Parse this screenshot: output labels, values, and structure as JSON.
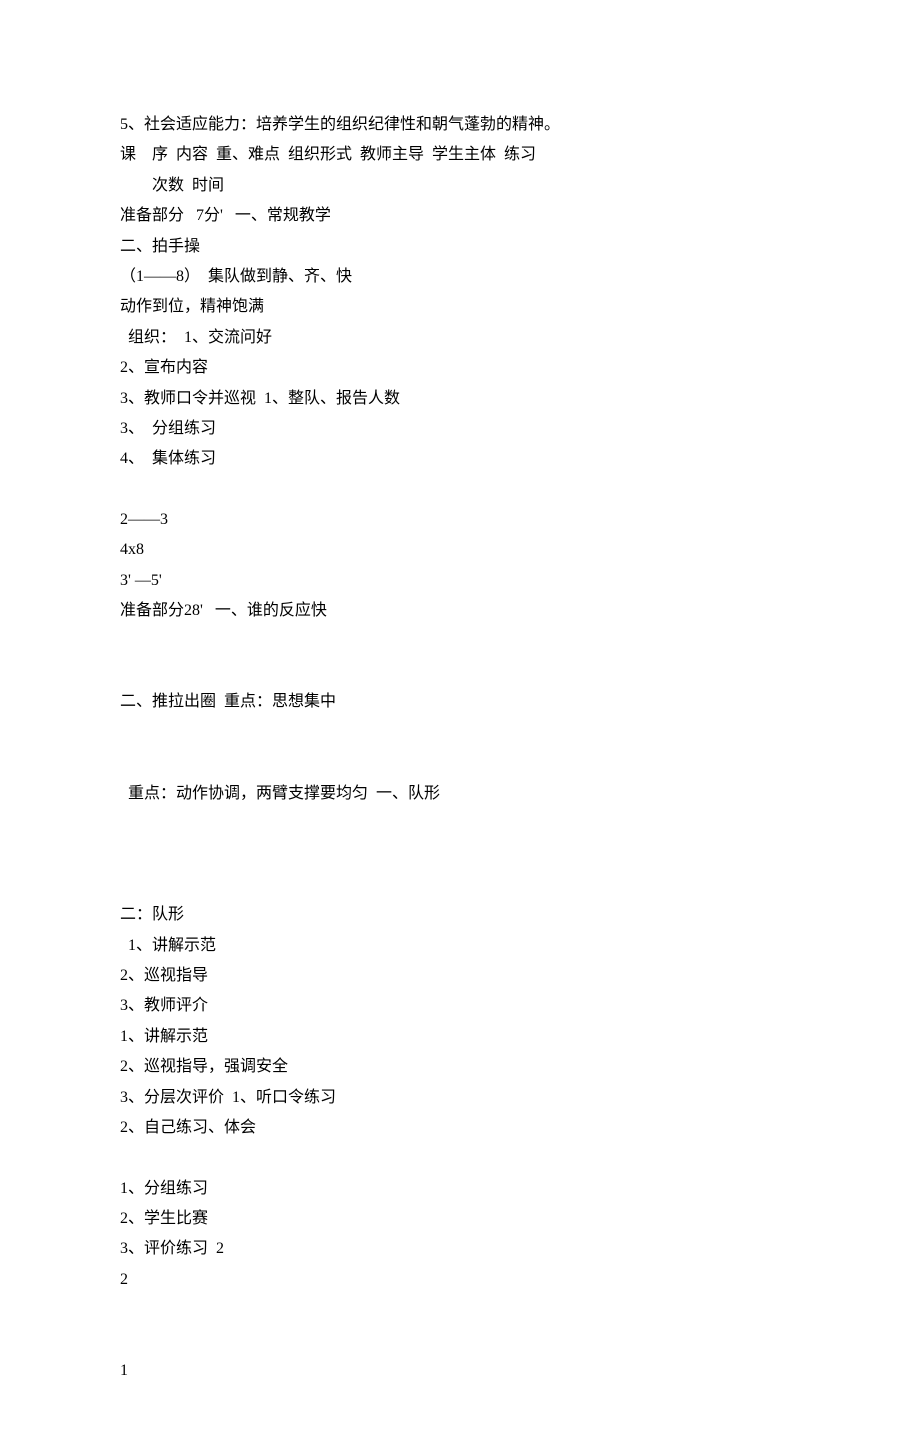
{
  "lines": [
    "5、社会适应能力：培养学生的组织纪律性和朝气蓬勃的精神。",
    "课    序  内容  重、难点  组织形式  教师主导  学生主体  练习",
    "        次数  时间",
    "准备部分   7分'   一、常规教学",
    "二、拍手操",
    "（1——8）  集队做到静、齐、快",
    "动作到位，精神饱满",
    "  组织：  1、交流问好",
    "2、宣布内容",
    "3、教师口令并巡视  1、整队、报告人数",
    "3、  分组练习",
    "4、  集体练习",
    "",
    "2——3",
    "4x8",
    "3' —5'",
    "准备部分28'   一、谁的反应快",
    "",
    "",
    "二、推拉出圈  重点：思想集中",
    "",
    "",
    "  重点：动作协调，两臂支撑要均匀  一、队形",
    "",
    "",
    "",
    "二：队形",
    "  1、讲解示范",
    "2、巡视指导",
    "3、教师评介",
    "1、讲解示范",
    "2、巡视指导，强调安全",
    "3、分层次评价  1、听口令练习",
    "2、自己练习、体会",
    "",
    "1、分组练习",
    "2、学生比赛",
    "3、评价练习  2",
    "2",
    "",
    "",
    "1"
  ]
}
